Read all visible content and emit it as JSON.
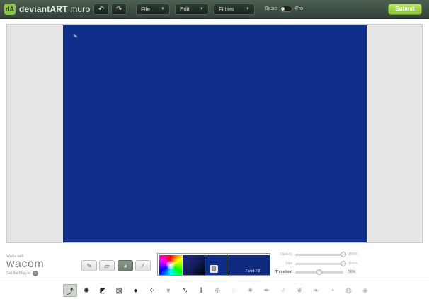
{
  "app": {
    "logo_mark": "dA",
    "brand_bold": "deviantART",
    "brand_rest": " muro"
  },
  "toolbar": {
    "undo_icon": "undo-icon",
    "redo_icon": "redo-icon",
    "file_label": "File",
    "edit_label": "Edit",
    "filters_label": "Filters",
    "mode_basic": "Basic",
    "mode_pro": "Pro",
    "mode_selected": "Basic",
    "submit_label": "Submit"
  },
  "canvas": {
    "fill_color": "#102f8a"
  },
  "wacom": {
    "works_with": "Works with",
    "brand": "wacom",
    "plug_text": "Get the Plug-In"
  },
  "tools": [
    {
      "name": "brush-tool",
      "icon": "paint-brush-icon",
      "active": false
    },
    {
      "name": "eraser-tool",
      "icon": "eraser-icon",
      "active": false
    },
    {
      "name": "fill-tool",
      "icon": "paint-bucket-icon",
      "active": true
    },
    {
      "name": "eyedropper-tool",
      "icon": "eyedropper-icon",
      "active": false
    }
  ],
  "color": {
    "current": "#0f2d86",
    "flood_label": "Flood Fill"
  },
  "sliders": [
    {
      "label": "Opacity",
      "value": "100%",
      "level": 1.0,
      "enabled": false
    },
    {
      "label": "Size",
      "value": "100%",
      "level": 1.0,
      "enabled": false
    },
    {
      "label": "Threshold",
      "value": "50%",
      "level": 0.5,
      "enabled": true
    }
  ],
  "brushes": [
    {
      "icon": "basic-brush-icon",
      "selected": true
    },
    {
      "icon": "soft-dot-icon",
      "selected": false
    },
    {
      "icon": "checker-brush-icon",
      "selected": false
    },
    {
      "icon": "hatch-brush-icon",
      "selected": false
    },
    {
      "icon": "ink-blot-icon",
      "selected": false
    },
    {
      "icon": "splatter-icon",
      "selected": false
    },
    {
      "icon": "comb-brush-icon",
      "selected": false
    },
    {
      "icon": "squiggle-brush-icon",
      "selected": false
    },
    {
      "icon": "lines-brush-icon",
      "selected": false
    },
    {
      "icon": "grid-circle-icon",
      "selected": false
    },
    {
      "icon": "dotted-circle-icon",
      "selected": false
    },
    {
      "icon": "starburst-icon",
      "selected": false
    },
    {
      "icon": "pen-nib-icon",
      "selected": false
    },
    {
      "icon": "figure-icon",
      "selected": false
    },
    {
      "icon": "feather-icon",
      "selected": false
    },
    {
      "icon": "leaf-icon",
      "selected": false
    },
    {
      "icon": "drop-icon",
      "selected": false
    },
    {
      "icon": "sphere-icon",
      "selected": false
    },
    {
      "icon": "cube-icon",
      "selected": false
    }
  ]
}
